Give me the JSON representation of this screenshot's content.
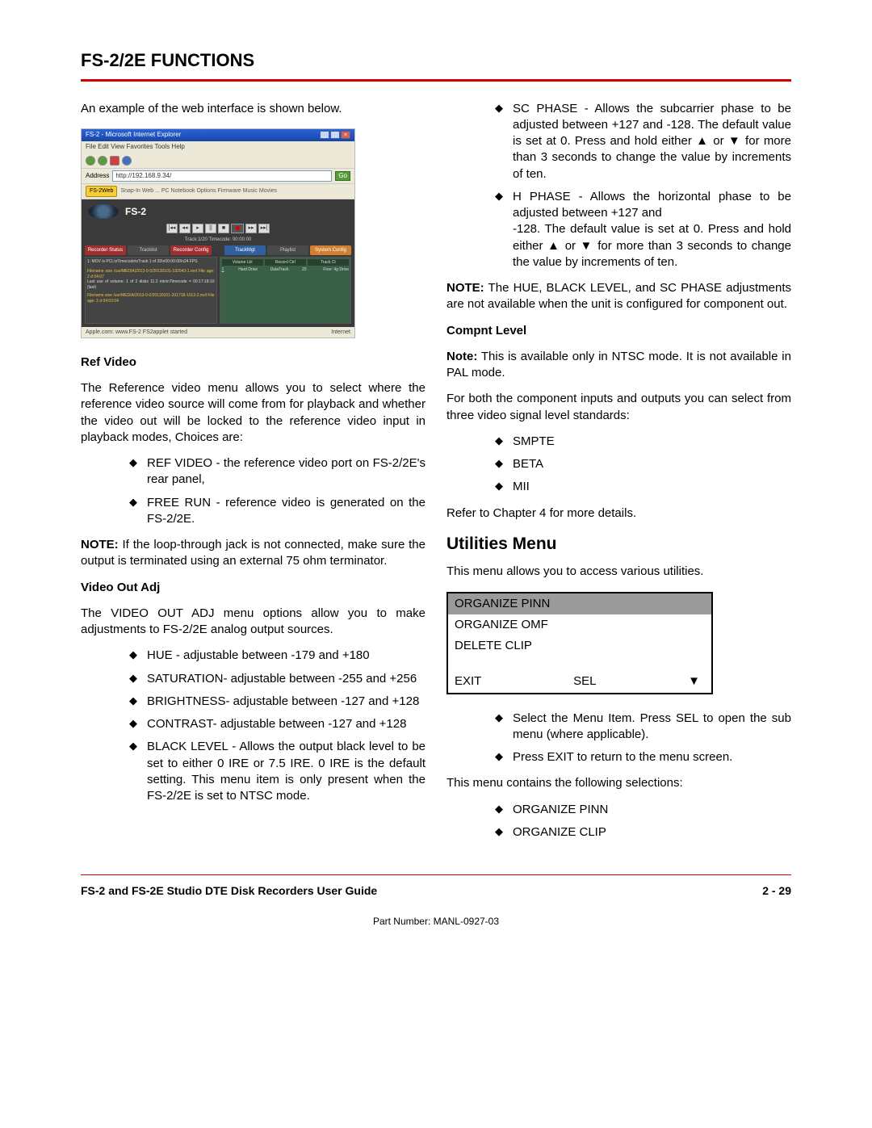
{
  "header": {
    "title": "FS-2/2E FUNCTIONS"
  },
  "left": {
    "intro": "An example of the web interface is shown below.",
    "fig": {
      "title": "FS-2 - Microsoft Internet Explorer",
      "menu": "File   Edit   View   Favorites   Tools   Help",
      "addr": "http://192.168.9.34/",
      "tablabel": "FS-2Web",
      "links": "Snap-In Web  ...  PC Notebook  Options  Firmware  Music  Movies",
      "logo": "FS-2",
      "center": "Track:1/20   Timecode: 00:00:00",
      "tabs": [
        "Recorder Status",
        "Tracklist",
        "Recorder Config",
        "TrackMgt",
        "Playlist",
        "System Config"
      ],
      "p1": "1: MOV is PCL\\nTimecode\\nTrack 1 of 20\\n00:00:00\\n24 FPS",
      "p2a": "Filename size /usr/MEDIA/2013-0-0/20130101-192043-1.mxf  File age: 2 d 04:07",
      "p2b": "Last use of volume: 1 of 2 disks 11.2 min\\nTimecode = 00:17:18:10 (last)",
      "p2c": "Filename size /usr/MEDIA/2013-0-0/20130101-201718-1012-2.mxf  File age: 2 d 04:02:04",
      "status_left": "Apple.com: www.FS-2 FS2applet started",
      "status_right": "Internet"
    },
    "refvideo_h": "Ref Video",
    "refvideo_p": "The Reference video menu allows you to select where the reference video source will come from for playback and whether the video out will be locked to the reference video input in playback modes, Choices are:",
    "refvideo_li1": "REF VIDEO - the reference video port on FS-2/2E's rear panel,",
    "refvideo_li2": "FREE RUN - reference video is generated on the FS-2/2E.",
    "refvideo_note_b": "NOTE:",
    "refvideo_note": " If the loop-through jack is not connected, make sure the output is terminated using an external 75 ohm terminator.",
    "videoout_h": "Video Out Adj",
    "videoout_p": "The VIDEO OUT ADJ menu options allow you to make adjustments to FS-2/2E analog output sources.",
    "vo_li1": "HUE - adjustable between -179 and +180",
    "vo_li2": "SATURATION- adjustable between -255 and +256",
    "vo_li3": "BRIGHTNESS- adjustable between -127 and +128",
    "vo_li4": "CONTRAST- adjustable between -127 and +128",
    "vo_li5": "BLACK LEVEL - Allows the output black level to be set to either 0 IRE or 7.5 IRE. 0 IRE is the default setting. This menu item is only present when the FS-2/2E is set to NTSC mode."
  },
  "right": {
    "sc_li": "SC PHASE - Allows the subcarrier phase to be adjusted between +127 and -128. The default value is set at 0. Press and hold either ▲ or ▼ for more than 3 seconds to change the value by increments of ten.",
    "hp_li_a": "H PHASE - Allows the horizontal phase to be adjusted between +127 and",
    "hp_li_b": "-128. The default value is set at 0. Press and hold either ▲ or ▼ for more than 3 seconds to change the value by increments of ten.",
    "note_b": "NOTE:",
    "note_txt": " The HUE, BLACK LEVEL, and SC PHASE adjustments are not available when the unit is configured for component out.",
    "compnt_h": "Compnt Level",
    "compnt_note_b": "Note:",
    "compnt_note": " This is available only in NTSC mode. It is not available in PAL mode.",
    "compnt_p": "For both the component inputs and outputs you can select from three video signal level standards:",
    "compnt_li1": "SMPTE",
    "compnt_li2": "BETA",
    "compnt_li3": "MII",
    "compnt_ref": "Refer to Chapter 4 for more details.",
    "util_h": "Utilities Menu",
    "util_p": "This menu allows you to access various utilities.",
    "menu": {
      "r1": "ORGANIZE PINN",
      "r2": "ORGANIZE OMF",
      "r3": "DELETE CLIP",
      "exit": "EXIT",
      "sel": "SEL",
      "arrow": "▼"
    },
    "util_li1": "Select the Menu Item. Press SEL to open the sub menu (where applicable).",
    "util_li2": "Press EXIT to return to the menu screen.",
    "util_contains": "This menu contains the following selections:",
    "util_c1": "ORGANIZE PINN",
    "util_c2": "ORGANIZE CLIP"
  },
  "footer": {
    "guide": "FS-2 and FS-2E Studio DTE Disk Recorders User Guide",
    "page": "2 - 29",
    "part": "Part Number: MANL-0927-03"
  }
}
